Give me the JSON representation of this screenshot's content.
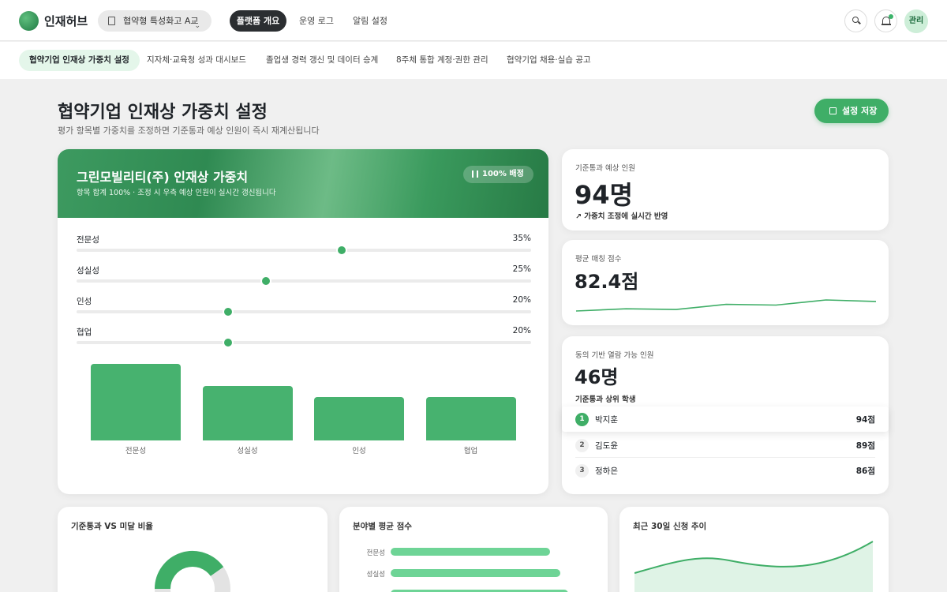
{
  "topbar": {
    "brand": "인재허브",
    "school": "협약형 특성화고 A교",
    "nav": [
      "플랫폼 개요",
      "운영 로그",
      "알림 설정"
    ],
    "admin": "관리"
  },
  "subtabs": [
    "협약기업 인재상 가중치 설정",
    "지자체·교육청 성과 대시보드",
    "졸업생 경력 갱신 및 데이터 승계",
    "8주체 통합 계정·권한 관리",
    "협약기업 채용·실습 공고"
  ],
  "header": {
    "title": "협약기업 인재상 가중치 설정",
    "subtitle": "평가 항목별 가중치를 조정하면 기준통과 예상 인원이 즉시 재계산됩니다",
    "save": "설정 저장"
  },
  "main": {
    "title": "그린모빌리티(주) 인재상 가중치",
    "subtitle": "항목 합계 100% · 조정 시 우측 예상 인원이 실시간 갱신됩니다",
    "badge": "100% 배정",
    "weights": [
      {
        "label": "전문성",
        "value": "35%",
        "level": 35
      },
      {
        "label": "성실성",
        "value": "25%",
        "level": 25
      },
      {
        "label": "인성",
        "value": "20%",
        "level": 20
      },
      {
        "label": "협업",
        "value": "20%",
        "level": 20
      }
    ]
  },
  "chart_data": {
    "type": "bar",
    "categories": [
      "전문성",
      "성실성",
      "인성",
      "협업"
    ],
    "values": [
      35,
      25,
      20,
      20
    ],
    "ylim": [
      0,
      35
    ]
  },
  "stats": {
    "expected_label": "기준통과 예상 인원",
    "expected_value": "94명",
    "expected_note": "가중치 조정에 실시간 반영",
    "avg_label": "평균 매칭 점수",
    "avg_value": "82.4점",
    "avg_trend": [
      82.0,
      82.3,
      82.2,
      82.9,
      82.8,
      83.5,
      83.3
    ],
    "consent_label": "동의 기반 열람 가능 인원",
    "consent_value": "46명",
    "top_label": "기준통과 상위 학생",
    "top": [
      {
        "rank": "1",
        "name": "박지훈",
        "score": "94점"
      },
      {
        "rank": "2",
        "name": "김도윤",
        "score": "89점"
      },
      {
        "rank": "3",
        "name": "정하은",
        "score": "86점"
      }
    ]
  },
  "bottom": {
    "ratio_title": "기준통과 VS 미달 비율",
    "field_title": "분야별 평균 점수",
    "field_labels": [
      "전문성",
      "성실성"
    ],
    "trend_title": "최근 30일 신청 추이"
  }
}
